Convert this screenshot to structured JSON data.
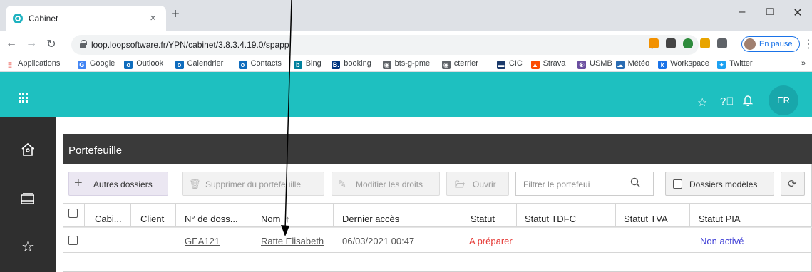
{
  "browser": {
    "tab_title": "Cabinet",
    "tab_close": "×",
    "new_tab": "+",
    "window_controls": {
      "minimize": "–",
      "maximize": "□",
      "close": "✕"
    },
    "url": "loop.loopsoftware.fr/YPN/cabinet/3.8.3.4.19.0/spapp",
    "profile_label": "En pause"
  },
  "bookmarks": [
    {
      "label": "Applications",
      "icon": "apps-grid-icon",
      "color": "#e8453c"
    },
    {
      "label": "Google",
      "icon": "google-icon",
      "color": "#4285f4",
      "glyph": "G"
    },
    {
      "label": "Outlook",
      "icon": "outlook-icon",
      "color": "#0f6cbd",
      "glyph": "o"
    },
    {
      "label": "Calendrier",
      "icon": "outlook-icon",
      "color": "#0f6cbd",
      "glyph": "o"
    },
    {
      "label": "Contacts",
      "icon": "outlook-icon",
      "color": "#0f6cbd",
      "glyph": "o"
    },
    {
      "label": "Bing",
      "icon": "bing-icon",
      "color": "#00809d",
      "glyph": "b"
    },
    {
      "label": "booking",
      "icon": "booking-icon",
      "color": "#003580",
      "glyph": "B."
    },
    {
      "label": "bts-g-pme",
      "icon": "globe-icon",
      "color": "#5f6368",
      "glyph": "◉"
    },
    {
      "label": "cterrier",
      "icon": "globe-icon",
      "color": "#5f6368",
      "glyph": "◉"
    },
    {
      "label": "CIC",
      "icon": "cic-icon",
      "color": "#1b3a6b",
      "glyph": "▬"
    },
    {
      "label": "Strava",
      "icon": "strava-icon",
      "color": "#fc4c02",
      "glyph": "▲"
    },
    {
      "label": "USMB",
      "icon": "usmb-icon",
      "color": "#6b4fa0",
      "glyph": "☯"
    },
    {
      "label": "Météo",
      "icon": "weather-icon",
      "color": "#2a6cb3",
      "glyph": "☁"
    },
    {
      "label": "Workspace",
      "icon": "workspace-icon",
      "color": "#1a73e8",
      "glyph": "k"
    },
    {
      "label": "Twitter",
      "icon": "twitter-icon",
      "color": "#1da1f2",
      "glyph": "✦"
    }
  ],
  "bookmarks_more": "»",
  "app": {
    "accent_color": "#1ec0c0",
    "user_initials": "ER",
    "panel_title": "Portefeuille",
    "toolbar": {
      "autres_dossiers": "Autres dossiers",
      "supprimer": "Supprimer du portefeuille",
      "modifier": "Modifier les droits",
      "ouvrir": "Ouvrir",
      "filter_placeholder": "Filtrer le portefeui",
      "dossiers_modeles": "Dossiers modèles"
    },
    "table": {
      "columns": [
        "Cabi...",
        "Client",
        "N° de doss...",
        "Nom",
        "Dernier accès",
        "Statut",
        "Statut TDFC",
        "Statut TVA",
        "Statut PIA"
      ],
      "sort_indicator": "↑",
      "rows": [
        {
          "cabinet": "",
          "client": "",
          "numero": "GEA121",
          "nom": "Ratte Elisabeth",
          "dernier_acces": "06/03/2021 00:47",
          "statut": "A préparer",
          "statut_tdfc": "",
          "statut_tva": "",
          "statut_pia": "Non activé"
        }
      ]
    },
    "status_colors": {
      "a_preparer": "#e53935",
      "non_active": "#3f3fd6"
    }
  }
}
